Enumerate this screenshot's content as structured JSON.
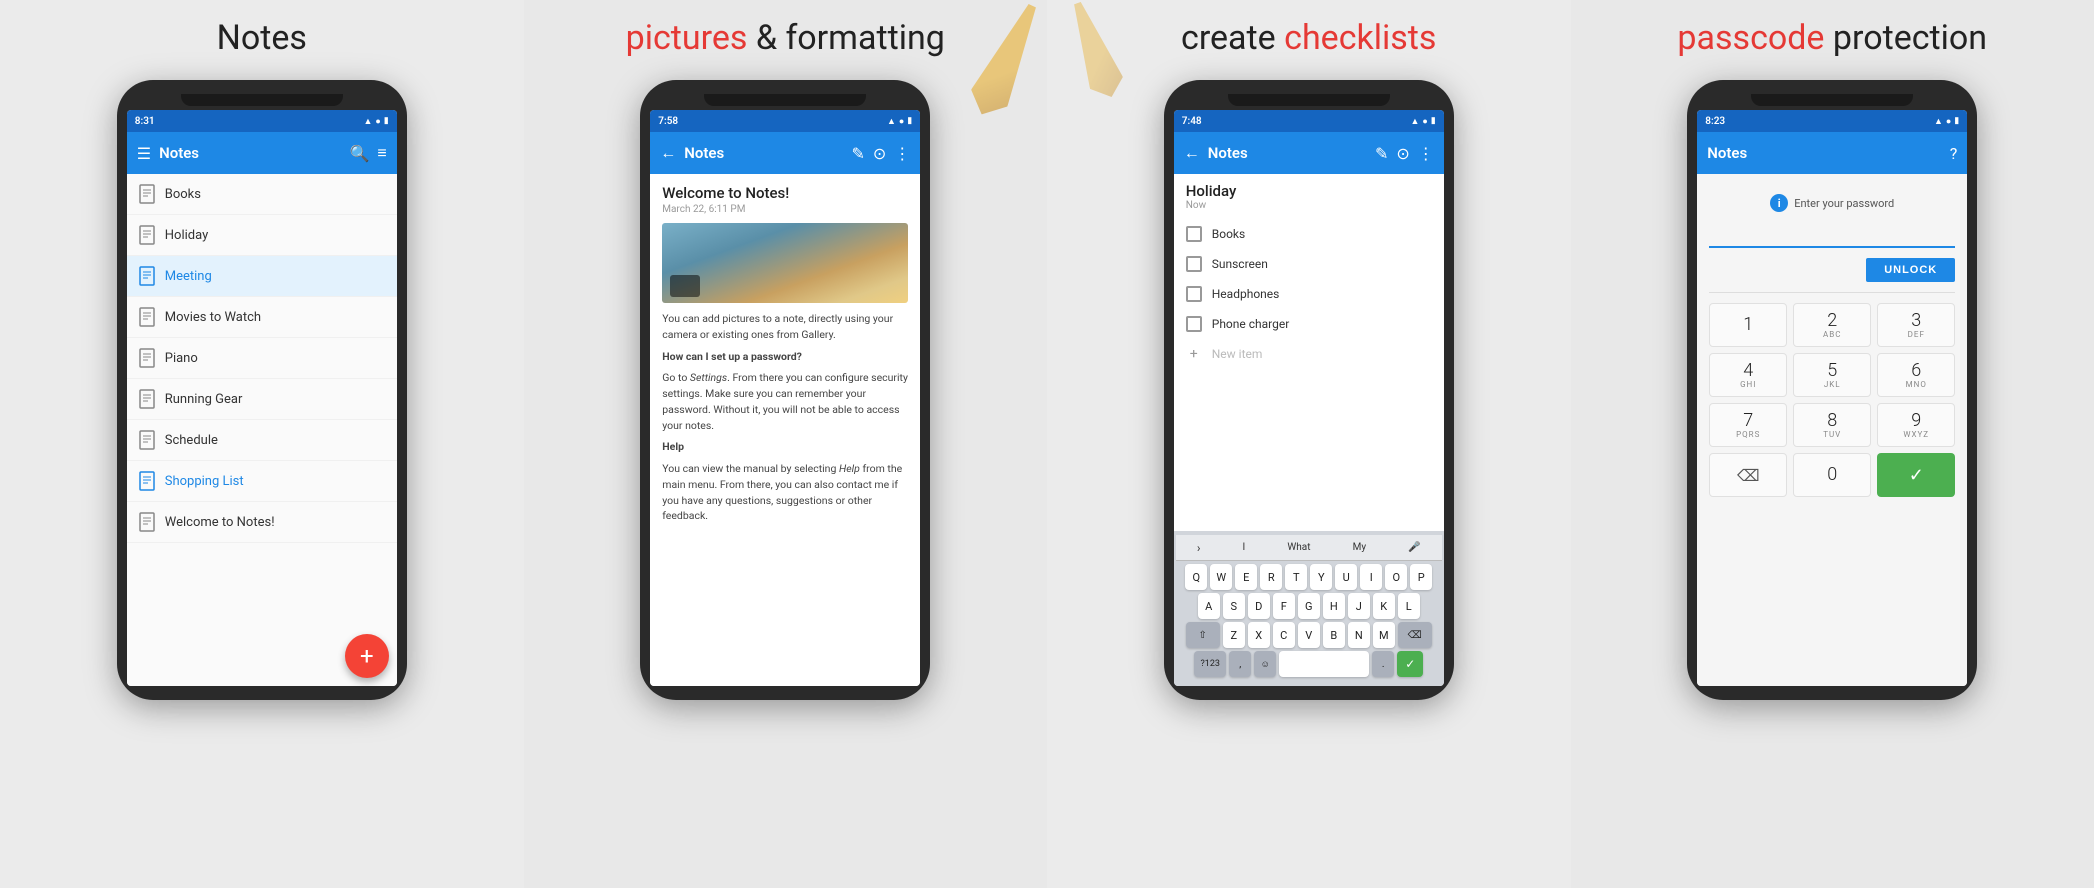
{
  "panels": [
    {
      "id": "panel1",
      "background": "#ebebeb",
      "title": "Notes",
      "title_red": false,
      "subtitle": null,
      "statusTime": "8:31",
      "appBarTitle": "Notes",
      "appBarIcons": [
        "☰",
        "🔍",
        "≡"
      ],
      "noteItems": [
        {
          "label": "Books",
          "active": false,
          "color": "normal",
          "icon": "doc"
        },
        {
          "label": "Holiday",
          "active": false,
          "color": "normal",
          "icon": "doc"
        },
        {
          "label": "Meeting",
          "active": false,
          "color": "blue",
          "icon": "doc-lines"
        },
        {
          "label": "Movies to Watch",
          "active": false,
          "color": "normal",
          "icon": "doc"
        },
        {
          "label": "Piano",
          "active": false,
          "color": "normal",
          "icon": "doc"
        },
        {
          "label": "Running Gear",
          "active": false,
          "color": "normal",
          "icon": "doc"
        },
        {
          "label": "Schedule",
          "active": false,
          "color": "normal",
          "icon": "doc"
        },
        {
          "label": "Shopping List",
          "active": false,
          "color": "blue",
          "icon": "doc-lines"
        },
        {
          "label": "Welcome to Notes!",
          "active": false,
          "color": "normal",
          "icon": "doc"
        }
      ],
      "fab": "+"
    },
    {
      "id": "panel2",
      "background": "#e8e8e8",
      "title": "pictures",
      "title_and": "& formatting",
      "title_red": true,
      "statusTime": "7:58",
      "appBarTitle": "Notes",
      "appBarIcons": [
        "←",
        "✎",
        "📷",
        "⋮"
      ],
      "noteTitle": "Welcome to Notes!",
      "noteDate": "March 22, 6:11 PM",
      "noteBody": [
        {
          "type": "text",
          "content": "You can add pictures to a note, directly using your camera or existing ones from Gallery."
        },
        {
          "type": "bold-heading",
          "content": "How can I set up a password?"
        },
        {
          "type": "text",
          "content": "Go to Settings. From there you can configure security settings. Make sure you can remember your password. Without it, you will not be able to access your notes."
        },
        {
          "type": "bold-heading",
          "content": "Help"
        },
        {
          "type": "text",
          "content": "You can view the manual by selecting Help from the main menu. From there, you can also contact me if you have any questions, suggestions or other feedback."
        }
      ]
    },
    {
      "id": "panel3",
      "background": "#ebebeb",
      "title": "create",
      "title_checklists": "checklists",
      "title_red": true,
      "statusTime": "7:48",
      "appBarTitle": "Notes",
      "appBarIcons": [
        "←",
        "✎",
        "📷",
        "⋮"
      ],
      "noteTitle": "Holiday",
      "noteTime": "Now",
      "checkItems": [
        {
          "label": "Books",
          "checked": false
        },
        {
          "label": "Sunscreen",
          "checked": false
        },
        {
          "label": "Headphones",
          "checked": false
        },
        {
          "label": "Phone charger",
          "checked": false
        }
      ],
      "newItemPlaceholder": "New item",
      "keyboardRows": [
        [
          "Q",
          "W",
          "E",
          "R",
          "T",
          "Y",
          "U",
          "I",
          "O",
          "P"
        ],
        [
          "A",
          "S",
          "D",
          "F",
          "G",
          "H",
          "J",
          "K",
          "L"
        ],
        [
          "⇧",
          "Z",
          "X",
          "C",
          "V",
          "B",
          "N",
          "M",
          "⌫"
        ],
        [
          "?123",
          ",",
          "☺",
          "",
          "",
          "",
          "",
          ".",
          "✓"
        ]
      ],
      "kbSuggestions": [
        ">",
        "I",
        "What",
        "My",
        "🎤"
      ]
    },
    {
      "id": "panel4",
      "background": "#e8e8e8",
      "title": "passcode",
      "title_protection": "protection",
      "title_red": true,
      "statusTime": "8:23",
      "appBarTitle": "Notes",
      "appBarIcons": [
        "?"
      ],
      "passcodeHint": "Enter your password",
      "unlockLabel": "UNLOCK",
      "numpadKeys": [
        {
          "num": "1",
          "letters": ""
        },
        {
          "num": "2",
          "letters": "ABC"
        },
        {
          "num": "3",
          "letters": "DEF"
        },
        {
          "num": "4",
          "letters": "GHI"
        },
        {
          "num": "5",
          "letters": "JKL"
        },
        {
          "num": "6",
          "letters": "MNO"
        },
        {
          "num": "7",
          "letters": "PQRS"
        },
        {
          "num": "8",
          "letters": "TUV"
        },
        {
          "num": "9",
          "letters": "WXYZ"
        },
        {
          "num": "del",
          "letters": ""
        },
        {
          "num": "0",
          "letters": ""
        },
        {
          "num": "check",
          "letters": ""
        }
      ]
    }
  ]
}
